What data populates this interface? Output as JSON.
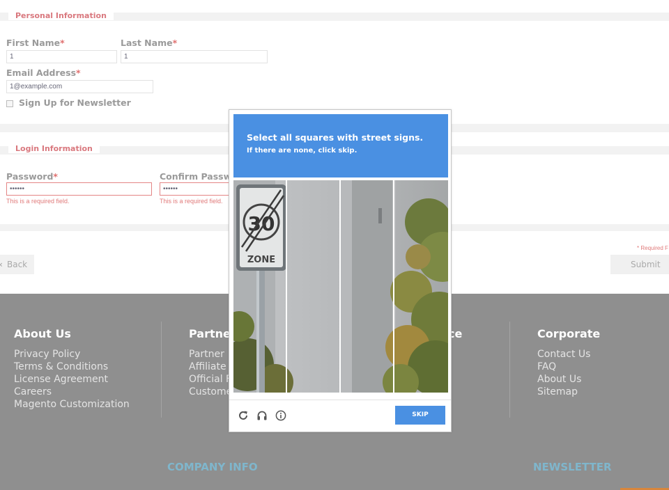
{
  "personal": {
    "legend": "Personal Information",
    "first_name_label": "First Name",
    "last_name_label": "Last Name",
    "email_label": "Email Address",
    "required_mark": "*",
    "first_name_value": "1",
    "last_name_value": "1",
    "email_value": "1@example.com",
    "newsletter_label": "Sign Up for Newsletter"
  },
  "login": {
    "legend": "Login Information",
    "password_label": "Password",
    "confirm_label": "Confirm Passwo",
    "password_value": "••••••",
    "confirm_value": "••••••",
    "error_text": "This is a required field."
  },
  "actions": {
    "back_label": "Back",
    "back_arrow": "‹",
    "submit_label": "Submit",
    "required_note": "* Required F"
  },
  "footer": {
    "columns": [
      {
        "title": "About Us",
        "links": [
          "Privacy Policy",
          "Terms & Conditions",
          "License Agreement",
          "Careers",
          "Magento Customization"
        ]
      },
      {
        "title": "Partner",
        "links": [
          "Partner",
          "Affiliate",
          "Official F",
          "Custome"
        ]
      },
      {
        "title": "ce",
        "links": []
      },
      {
        "title": "Corporate",
        "links": [
          "Contact Us",
          "FAQ",
          "About Us",
          "Sitemap"
        ]
      }
    ],
    "company_info": "COMPANY INFO",
    "newsletter": "NEWSLETTER"
  },
  "captcha": {
    "title_plain": "Select all squares with ",
    "title_bold": "street signs.",
    "subtitle": "If there are none, click skip.",
    "skip_label": "SKIP",
    "sign_zone_text": "ZONE",
    "sign_number": "30",
    "icons": [
      "reload-icon",
      "audio-icon",
      "info-icon"
    ],
    "header_color": "#4a90e2"
  }
}
